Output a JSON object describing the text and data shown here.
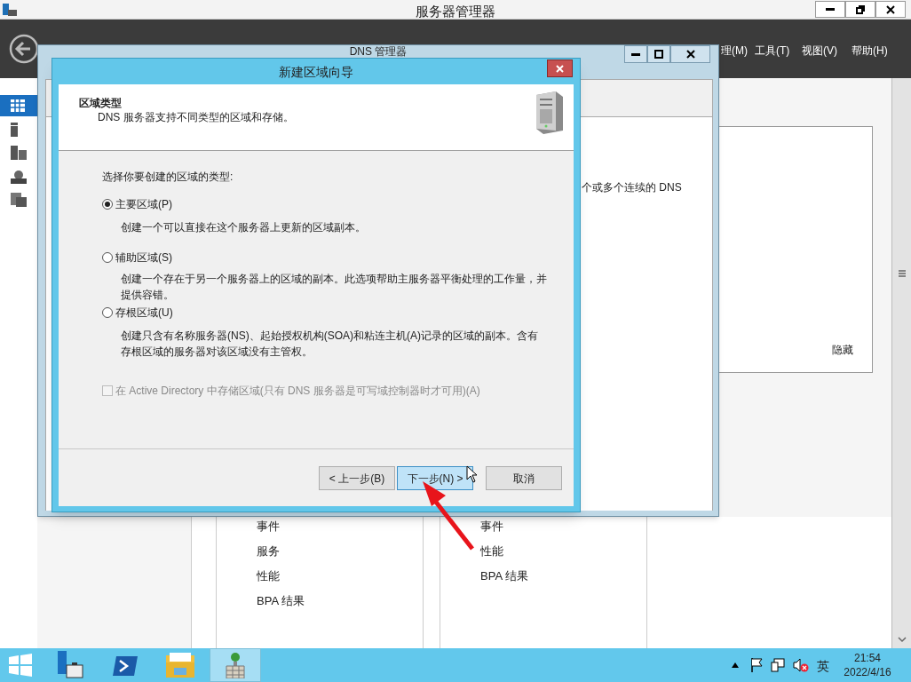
{
  "server_manager": {
    "title": "服务器管理器",
    "menu": [
      {
        "label": "理(M)"
      },
      {
        "label": "工具(T)"
      },
      {
        "label": "视图(V)"
      },
      {
        "label": "帮助(H)"
      }
    ],
    "sidebar": [
      {
        "selected": true
      },
      {
        "selected": false
      },
      {
        "selected": false
      },
      {
        "selected": false
      },
      {
        "selected": false
      }
    ],
    "hide_label": "隐藏",
    "tiles": [
      {
        "items": [
          "事件",
          "服务",
          "性能",
          "BPA 结果"
        ]
      },
      {
        "items": [
          "事件",
          "性能",
          "BPA 结果"
        ]
      }
    ]
  },
  "dns_manager": {
    "title": "DNS 管理器",
    "text_fragment": "个或多个连续的 DNS"
  },
  "wizard": {
    "title": "新建区域向导",
    "heading": "区域类型",
    "subheading": "DNS 服务器支持不同类型的区域和存储。",
    "prompt": "选择你要创建的区域的类型:",
    "options": [
      {
        "label": "主要区域(P)",
        "description": "创建一个可以直接在这个服务器上更新的区域副本。",
        "selected": true
      },
      {
        "label": "辅助区域(S)",
        "description": "创建一个存在于另一个服务器上的区域的副本。此选项帮助主服务器平衡处理的工作量，并提供容错。",
        "selected": false
      },
      {
        "label": "存根区域(U)",
        "description": "创建只含有名称服务器(NS)、起始授权机构(SOA)和粘连主机(A)记录的区域的副本。含有存根区域的服务器对该区域没有主管权。",
        "selected": false
      }
    ],
    "ad_checkbox": {
      "label": "在 Active Directory 中存储区域(只有 DNS 服务器是可写域控制器时才可用)(A)",
      "checked": false,
      "disabled": true
    },
    "buttons": [
      {
        "label": "< 上一步(B)",
        "highlighted": false
      },
      {
        "label": "下一步(N) >",
        "highlighted": true
      },
      {
        "label": "取消",
        "highlighted": false
      }
    ]
  },
  "taskbar": {
    "apps": [
      {
        "selected": false
      },
      {
        "selected": false
      },
      {
        "selected": false
      },
      {
        "selected": true
      }
    ],
    "input_method": "英",
    "time": "21:54",
    "date": "2022/4/16"
  }
}
